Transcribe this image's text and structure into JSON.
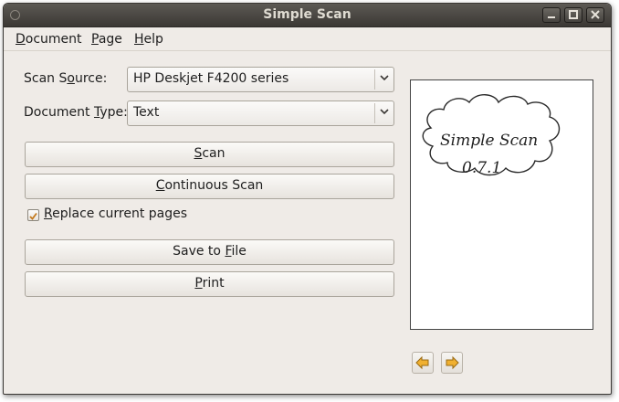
{
  "window": {
    "title": "Simple Scan"
  },
  "menu": [
    {
      "id": "document",
      "mnemonic": "D",
      "rest": "ocument"
    },
    {
      "id": "page",
      "mnemonic": "P",
      "rest": "age"
    },
    {
      "id": "help",
      "mnemonic": "H",
      "rest": "elp"
    }
  ],
  "scan_source": {
    "label_pre": "Scan S",
    "label_mn": "o",
    "label_post": "urce:",
    "value": "HP Deskjet F4200 series"
  },
  "document_type": {
    "label_pre": "Document ",
    "label_mn": "T",
    "label_post": "ype:",
    "value": "Text"
  },
  "buttons": {
    "scan": {
      "mn": "S",
      "post": "can"
    },
    "continuous_scan": {
      "mn": "C",
      "post": "ontinuous Scan"
    },
    "save": {
      "pre": "Save to ",
      "mn": "F",
      "post": "ile"
    },
    "print": {
      "mn": "P",
      "post": "rint"
    }
  },
  "replace_pages": {
    "mn": "R",
    "post": "eplace current pages",
    "checked": true
  },
  "preview": {
    "line1": "Simple Scan",
    "line2": "0.7.1"
  },
  "colors": {
    "accent": "#e0a020",
    "window_bg": "#efebe7",
    "titlebar": "#3b3834"
  },
  "icons": {
    "prev": "arrow-left-icon",
    "next": "arrow-right-icon",
    "minimize": "minimize-icon",
    "maximize": "maximize-icon",
    "close": "close-icon",
    "check": "checkmark-icon"
  }
}
